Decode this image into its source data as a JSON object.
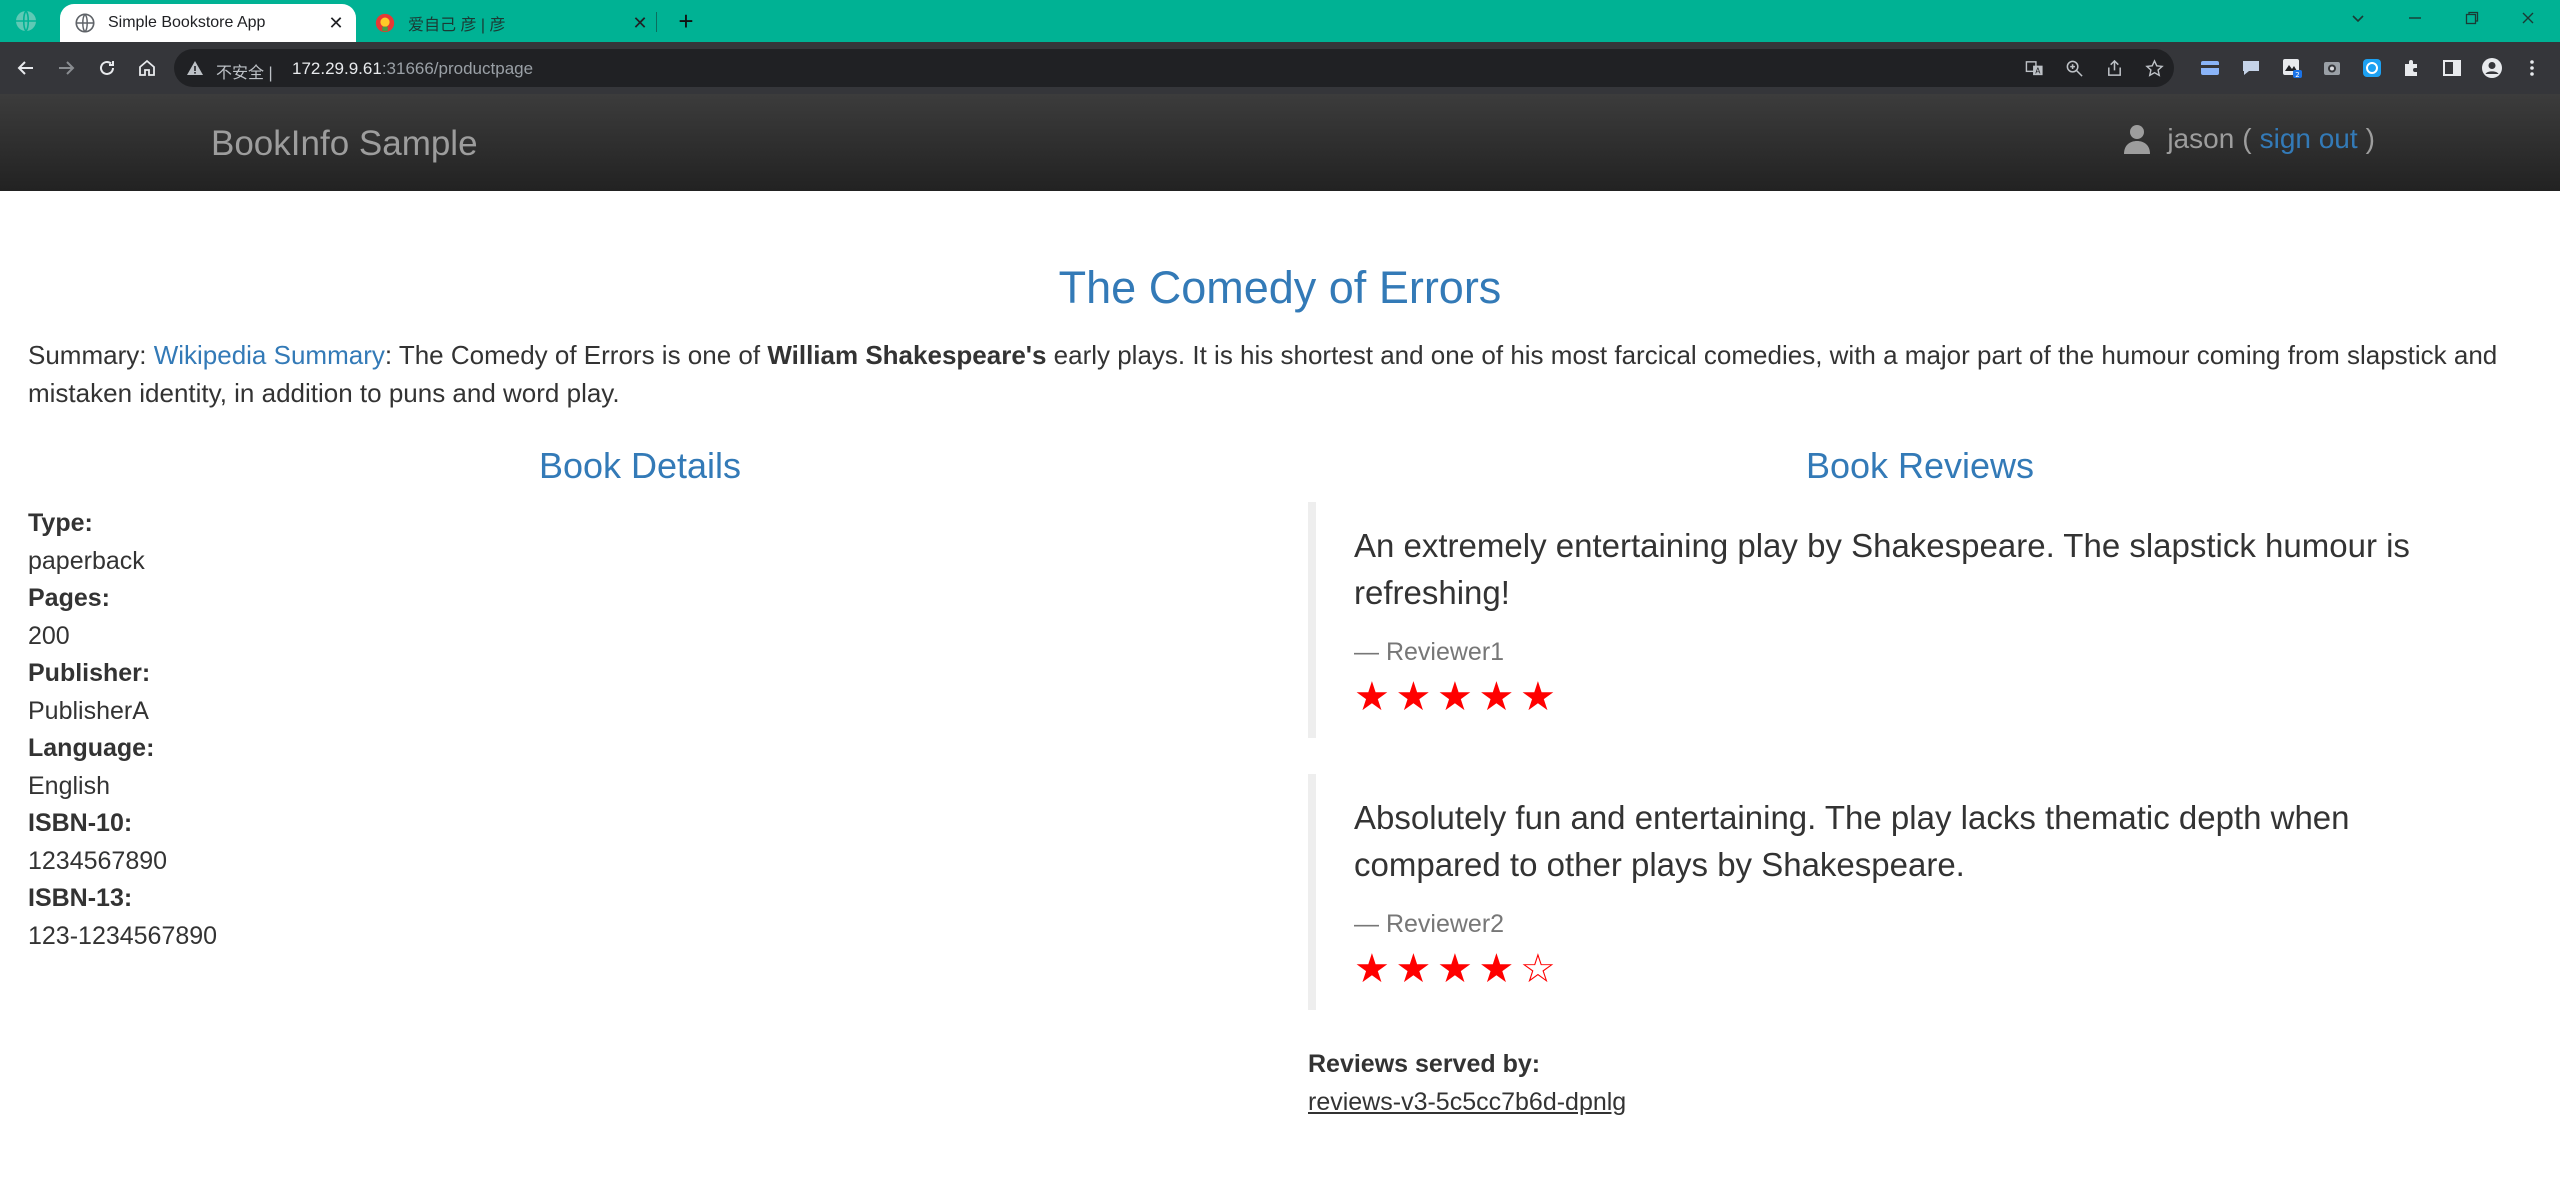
{
  "browser": {
    "tabs": [
      {
        "title": "Simple Bookstore App",
        "active": true
      },
      {
        "title": "爱自己 彦 | 彦",
        "active": false
      }
    ],
    "address": {
      "security_label": "不安全 |",
      "host": "172.29.9.61",
      "path": ":31666/productpage"
    }
  },
  "app": {
    "brand": "BookInfo Sample",
    "user": {
      "name": "jason",
      "open_paren": "(",
      "signout_label": "sign out",
      "close_paren": ")"
    }
  },
  "book": {
    "title": "The Comedy of Errors",
    "summary": {
      "prefix": "Summary: ",
      "link": "Wikipedia Summary",
      "text_before_bold": ": The Comedy of Errors is one of ",
      "bold": "William Shakespeare's",
      "text_after_bold": " early plays. It is his shortest and one of his most farcical comedies, with a major part of the humour coming from slapstick and mistaken identity, in addition to puns and word play."
    }
  },
  "details": {
    "heading": "Book Details",
    "fields": [
      {
        "label": "Type:",
        "value": "paperback"
      },
      {
        "label": "Pages:",
        "value": "200"
      },
      {
        "label": "Publisher:",
        "value": "PublisherA"
      },
      {
        "label": "Language:",
        "value": "English"
      },
      {
        "label": "ISBN-10:",
        "value": "1234567890"
      },
      {
        "label": "ISBN-13:",
        "value": "123-1234567890"
      }
    ]
  },
  "reviews": {
    "heading": "Book Reviews",
    "items": [
      {
        "text": "An extremely entertaining play by Shakespeare. The slapstick humour is refreshing!",
        "author": "— Reviewer1",
        "rating": 5,
        "max_rating": 5
      },
      {
        "text": "Absolutely fun and entertaining. The play lacks thematic depth when compared to other plays by Shakespeare.",
        "author": "— Reviewer2",
        "rating": 4,
        "max_rating": 5
      }
    ],
    "star_color": "#ff0000",
    "served_label": "Reviews served by:",
    "served_by": "reviews-v3-5c5cc7b6d-dpnlg"
  },
  "theme": {
    "tab_strip": "#00b294",
    "link_blue": "#337ab7",
    "navbar": "#222222"
  }
}
